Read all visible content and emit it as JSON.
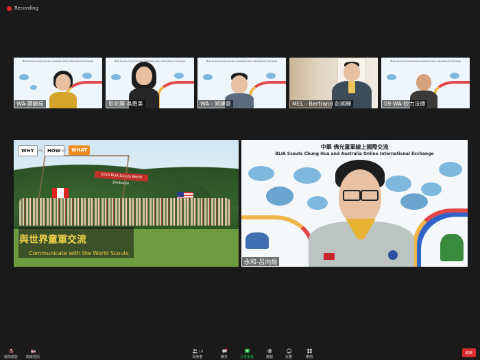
{
  "recording": {
    "label": "Recording"
  },
  "participants": [
    {
      "name": "WA-蕭錦苑"
    },
    {
      "name": "彰化團 吳惠美"
    },
    {
      "name": "WA - 郑建豪"
    },
    {
      "name": "MEL - Bertrand 彭國輝"
    },
    {
      "name": "09-WA-妙力法師"
    }
  ],
  "shared_screen": {
    "chips": [
      "WHY",
      "HOW",
      "WHAT"
    ],
    "banner": "2019 BLIA Scouts World Jamboree",
    "caption_zh": "與世界童軍交流",
    "caption_en": "Communicate with the World Scouts"
  },
  "speaker": {
    "title_zh": "中華 佛光童軍線上國際交流",
    "title_en": "BLIA Scouts Chung Hua and Australia Online International Exchange",
    "name": "永和-呂向煬"
  },
  "toolbar": {
    "mute": "解除靜音",
    "video": "開啟視訊",
    "participants": "與會者",
    "participant_count": "19",
    "chat": "聊天",
    "share": "分享螢幕",
    "record": "錄製",
    "reactions": "反應",
    "apps": "應用",
    "end": "結束"
  },
  "colors": {
    "accent": "#e02828",
    "share_green": "#23b44a",
    "caption_yellow": "#f5d44a"
  }
}
